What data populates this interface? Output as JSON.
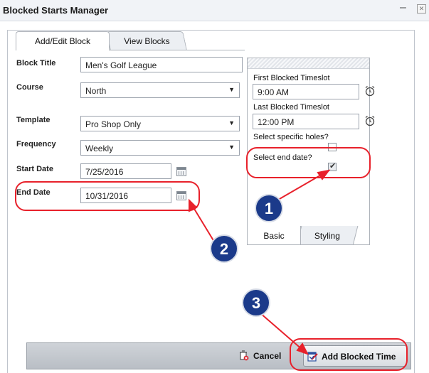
{
  "window": {
    "title": "Blocked Starts Manager",
    "minimize_glyph": "–",
    "close_glyph": "✕"
  },
  "tabs": [
    {
      "label": "Add/Edit Block",
      "active": true
    },
    {
      "label": "View Blocks",
      "active": false
    }
  ],
  "form": {
    "block_title": {
      "label": "Block Title",
      "value": "Men's Golf League"
    },
    "course": {
      "label": "Course",
      "value": "North"
    },
    "template": {
      "label": "Template",
      "value": "Pro Shop Only"
    },
    "frequency": {
      "label": "Frequency",
      "value": "Weekly"
    },
    "start_date": {
      "label": "Start Date",
      "value": "7/25/2016"
    },
    "end_date": {
      "label": "End Date",
      "value": "10/31/2016"
    }
  },
  "panel": {
    "first_timeslot": {
      "label": "First Blocked Timeslot",
      "value": "9:00 AM"
    },
    "last_timeslot": {
      "label": "Last Blocked Timeslot",
      "value": "12:00 PM"
    },
    "specific_holes": {
      "label": "Select specific holes?",
      "checked": false
    },
    "end_date_toggle": {
      "label": "Select end date?",
      "checked": true
    },
    "tabs": [
      {
        "label": "Basic",
        "active": true
      },
      {
        "label": "Styling",
        "active": false
      }
    ]
  },
  "footer": {
    "cancel_label": "Cancel",
    "add_label": "Add Blocked Time"
  },
  "annotations": {
    "step1": "1",
    "step2": "2",
    "step3": "3",
    "accent_color": "#e8212b",
    "badge_color": "#1b3a8a"
  },
  "icons": [
    "calendar-icon",
    "alarm-clock-icon",
    "cancel-icon",
    "add-blocked-time-icon",
    "checkbox-check-icon"
  ]
}
